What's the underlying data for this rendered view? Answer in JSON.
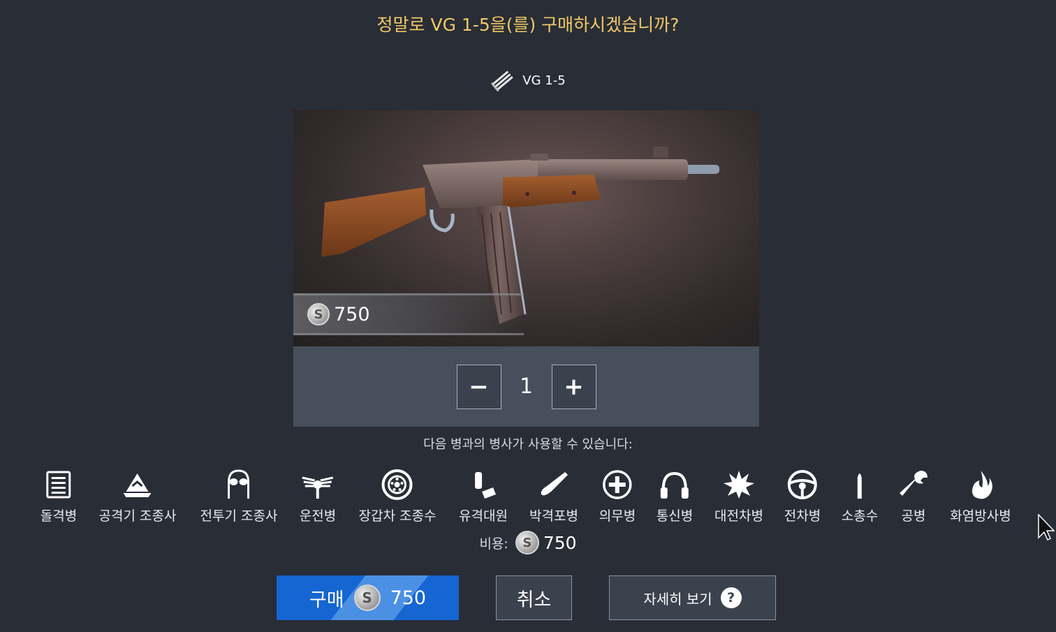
{
  "dialog": {
    "title": "정말로 VG 1-5을(를) 구매하시겠습니까?",
    "item_name": "VG 1-5",
    "item_icon": "ammo-bullets-icon",
    "price": "750",
    "currency_icon": "silver-coin-icon",
    "currency_symbol": "S"
  },
  "quantity": {
    "minus_label": "−",
    "value": "1",
    "plus_label": "+"
  },
  "usable_by_text": "다음 병과의 병사가 사용할 수 있습니다:",
  "classes": [
    {
      "label": "돌격병",
      "icon": "assault-list-icon"
    },
    {
      "label": "공격기 조종사",
      "icon": "attacker-pilot-cap-icon"
    },
    {
      "label": "전투기 조종사",
      "icon": "fighter-pilot-helmet-icon"
    },
    {
      "label": "운전병",
      "icon": "driver-wings-icon"
    },
    {
      "label": "장갑차 조종수",
      "icon": "wheel-icon"
    },
    {
      "label": "유격대원",
      "icon": "raider-grenade-icon"
    },
    {
      "label": "박격포병",
      "icon": "mortar-shell-icon"
    },
    {
      "label": "의무병",
      "icon": "medic-cross-icon"
    },
    {
      "label": "통신병",
      "icon": "radio-headphones-icon"
    },
    {
      "label": "대전차병",
      "icon": "explosion-icon"
    },
    {
      "label": "전차병",
      "icon": "steering-wheel-icon"
    },
    {
      "label": "소총수",
      "icon": "bullet-icon"
    },
    {
      "label": "공병",
      "icon": "wrench-icon"
    },
    {
      "label": "화염방사병",
      "icon": "flame-icon"
    }
  ],
  "cost": {
    "label": "비용:",
    "value": "750"
  },
  "buttons": {
    "buy_label": "구매",
    "buy_price": "750",
    "cancel_label": "취소",
    "details_label": "자세히 보기",
    "details_icon": "question-icon",
    "details_symbol": "?"
  },
  "colors": {
    "background": "#282d36",
    "title": "#f2c866",
    "buy_button": "#1565d2",
    "panel": "#464f5b"
  }
}
